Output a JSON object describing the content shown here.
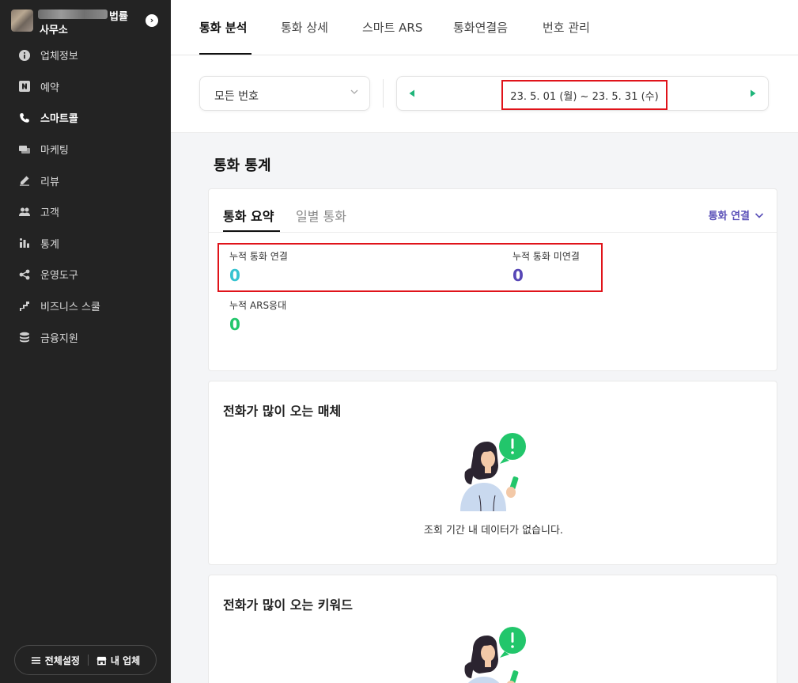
{
  "sidebar": {
    "business_name_line1": "법률",
    "business_name_line2": "사무소",
    "toggle_glyph": "›",
    "items": [
      {
        "label": "업체정보",
        "icon": "info-icon",
        "active": false
      },
      {
        "label": "예약",
        "icon": "naver-n-icon",
        "active": false
      },
      {
        "label": "스마트콜",
        "icon": "phone-icon",
        "active": true
      },
      {
        "label": "마케팅",
        "icon": "marketing-icon",
        "active": false
      },
      {
        "label": "리뷰",
        "icon": "pencil-icon",
        "active": false
      },
      {
        "label": "고객",
        "icon": "users-icon",
        "active": false
      },
      {
        "label": "통계",
        "icon": "stats-icon",
        "active": false
      },
      {
        "label": "운영도구",
        "icon": "share-icon",
        "active": false
      },
      {
        "label": "비즈니스 스쿨",
        "icon": "stairs-icon",
        "active": false
      },
      {
        "label": "금융지원",
        "icon": "coins-icon",
        "active": false
      }
    ],
    "bottom": {
      "settings_label": "전체설정",
      "my_business_label": "내 업체"
    }
  },
  "topnav": {
    "tabs": [
      {
        "label": "통화 분석",
        "active": true
      },
      {
        "label": "통화 상세",
        "active": false
      },
      {
        "label": "스마트 ARS",
        "active": false
      },
      {
        "label": "통화연결음",
        "active": false
      },
      {
        "label": "번호 관리",
        "active": false
      }
    ]
  },
  "filters": {
    "number_select": "모든 번호",
    "date_range": "23. 5. 01 (월) ~ 23. 5. 31 (수)"
  },
  "stats_section": {
    "title": "통화 통계",
    "tabs": [
      {
        "label": "통화 요약",
        "active": true
      },
      {
        "label": "일별 통화",
        "active": false
      }
    ],
    "dropdown_label": "통화 연결",
    "metrics": [
      {
        "label": "누적 통화 연결",
        "value": "0"
      },
      {
        "label": "누적 통화 미연결",
        "value": "0"
      },
      {
        "label": "누적 ARS응대",
        "value": "0"
      }
    ]
  },
  "media_section": {
    "title": "전화가 많이 오는 매체",
    "empty_text": "조회 기간 내 데이터가 없습니다."
  },
  "keyword_section": {
    "title": "전화가 많이 오는 키워드"
  },
  "colors": {
    "connected": "#35c3d0",
    "missed": "#5747b6",
    "ars": "#22c66b",
    "accent": "#5a50b8",
    "highlight": "#e0131a",
    "arrow": "#1fb57a"
  }
}
